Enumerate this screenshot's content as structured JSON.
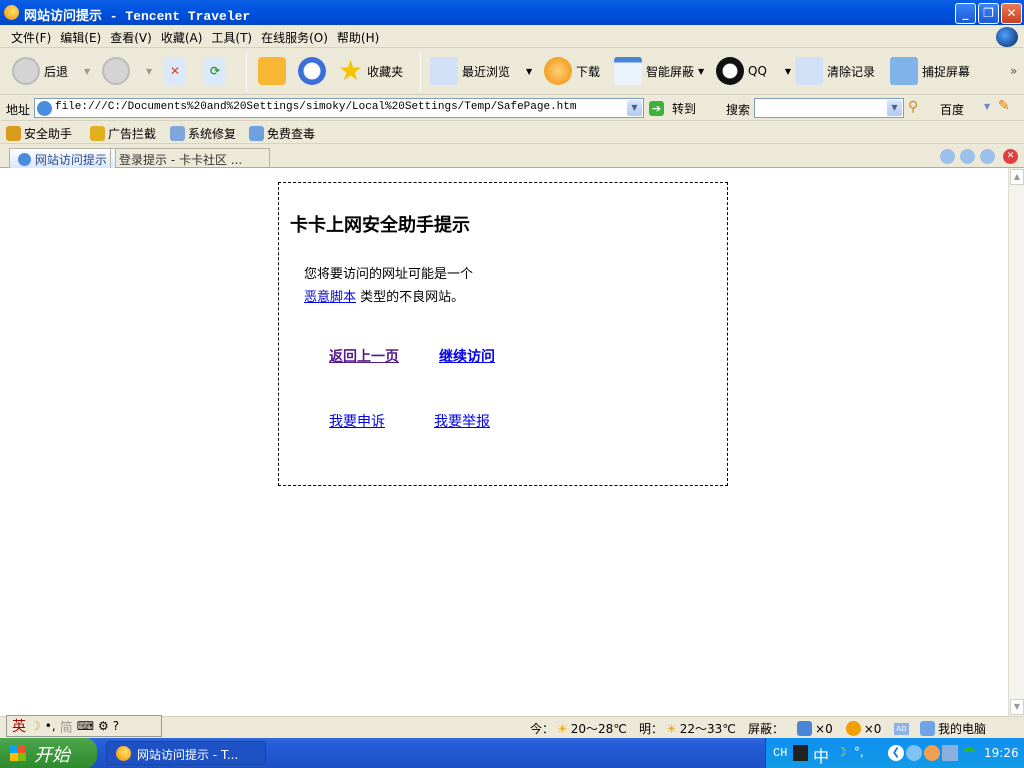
{
  "window": {
    "title": "网站访问提示 - Tencent Traveler"
  },
  "menu": [
    "文件(F)",
    "编辑(E)",
    "查看(V)",
    "收藏(A)",
    "工具(T)",
    "在线服务(O)",
    "帮助(H)"
  ],
  "toolbar": {
    "back": "后退",
    "favorites": "收藏夹",
    "recent": "最近浏览",
    "download": "下载",
    "smart_block": "智能屏蔽",
    "qq": "QQ",
    "clear": "清除记录",
    "capture": "捕捉屏幕",
    "more": "»"
  },
  "address": {
    "label": "地址",
    "url": "file:///C:/Documents%20and%20Settings/simoky/Local%20Settings/Temp/SafePage.htm",
    "go": "转到",
    "search_label": "搜索",
    "search_value": "",
    "engine": "百度"
  },
  "links": [
    "安全助手",
    "广告拦截",
    "系统修复",
    "免费查毒"
  ],
  "tabs": [
    {
      "label": "网站访问提示"
    },
    {
      "label": "登录提示 - 卡卡社区 ..."
    }
  ],
  "page": {
    "title": "卡卡上网安全助手提示",
    "line1": "您将要访问的网址可能是一个",
    "type_link": "恶意脚本",
    "line2": "类型的不良网站。",
    "back_link": "返回上一页",
    "continue_link": "继续访问",
    "appeal_link": "我要申诉",
    "report_link": "我要举报"
  },
  "status": {
    "ime": [
      "英",
      "简"
    ],
    "today_label": "今：",
    "today_temp": "20～28℃",
    "tomorrow_label": "明：",
    "tomorrow_temp": "22～33℃",
    "block_label": "屏蔽：",
    "popup_count": "×0",
    "ad_count": "×0",
    "ad_icon": "AD",
    "computer": "我的电脑"
  },
  "taskbar": {
    "start": "开始",
    "task": "网站访问提示 - T...",
    "lang": "CH",
    "ime": "中",
    "time": "19:26"
  }
}
